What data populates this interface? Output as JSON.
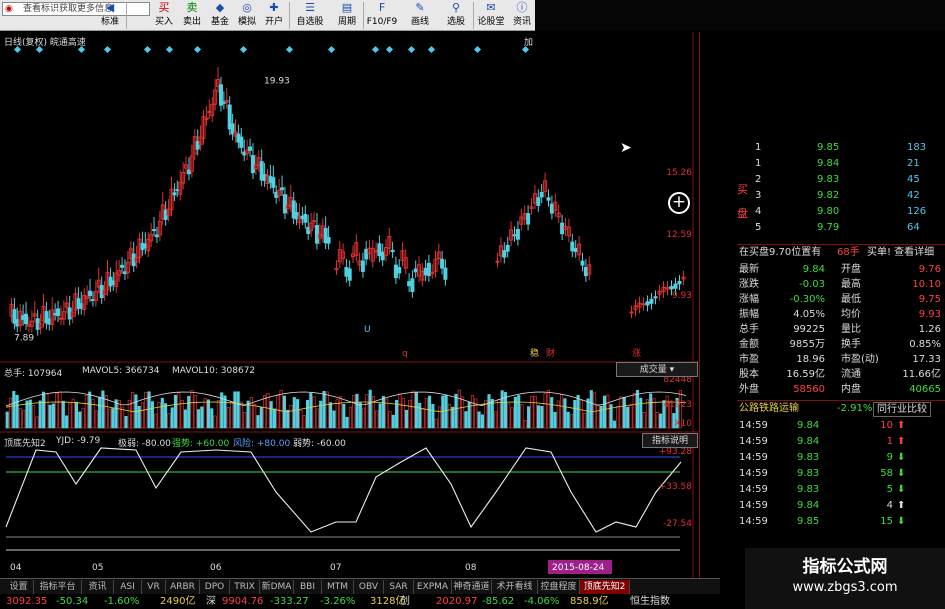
{
  "toolbar": {
    "search_placeholder": "查看标识获取更多信息",
    "buttons": [
      {
        "label": "标准",
        "icon": "arrow-left-icon"
      },
      {
        "label": "买入",
        "icon": "buy-icon"
      },
      {
        "label": "卖出",
        "icon": "sell-icon"
      },
      {
        "label": "基金",
        "icon": "fund-icon"
      },
      {
        "label": "模拟",
        "icon": "simulate-icon"
      },
      {
        "label": "开户",
        "icon": "open-account-icon"
      },
      {
        "label": "自选股",
        "icon": "watchlist-icon"
      },
      {
        "label": "周期",
        "icon": "period-icon"
      },
      {
        "label": "F10/F9",
        "icon": "f10-icon"
      },
      {
        "label": "画线",
        "icon": "draw-line-icon"
      },
      {
        "label": "选股",
        "icon": "select-stock-icon"
      },
      {
        "label": "论股堂",
        "icon": "forum-icon"
      },
      {
        "label": "资讯",
        "icon": "news-icon"
      }
    ]
  },
  "chart": {
    "header": "日线(复权)  皖通高速",
    "header_right": "加",
    "high_label": "19.93",
    "low_label": "7.89",
    "price_ticks": [
      "15.26",
      "12.59",
      "9.93"
    ],
    "markers": {
      "m1": "U",
      "m2": "q",
      "m3": "稳",
      "m4": "财",
      "m5": "涨"
    },
    "vol_header": {
      "total": "总手: 107964",
      "mavol5": "MAVOL5: 366734",
      "mavol10": "MAVOL10: 308672"
    },
    "vol_button": "成交量",
    "vol_ticks": [
      "82448",
      "41923",
      "X10"
    ],
    "ind_header": {
      "name": "顶底先知2",
      "yjd": "YJD: -9.79",
      "weak": "极弱: -80.00",
      "strong": "强势: +60.00",
      "risk": "风险: +80.00",
      "weakness": "弱势: -60.00"
    },
    "ind_button": "指标说明",
    "ind_ticks": [
      "+93.28",
      "+33.58",
      "-27.54"
    ],
    "date_labels": [
      "04",
      "05",
      "06",
      "07",
      "08"
    ],
    "date_highlight": "2015-08-24"
  },
  "chart_data": {
    "type": "candlestick",
    "price_high": 19.93,
    "price_low": 7.89,
    "ylim": [
      7.0,
      21.0
    ]
  },
  "quote": {
    "buy_label": "买盘",
    "order_book": [
      {
        "lvl": "1",
        "price": "9.85",
        "vol": "183"
      },
      {
        "lvl": "1",
        "price": "9.84",
        "vol": "21"
      },
      {
        "lvl": "2",
        "price": "9.83",
        "vol": "45"
      },
      {
        "lvl": "3",
        "price": "9.82",
        "vol": "42"
      },
      {
        "lvl": "4",
        "price": "9.80",
        "vol": "126"
      },
      {
        "lvl": "5",
        "price": "9.79",
        "vol": "64"
      }
    ],
    "pending_text": "在买盘9.70位置有",
    "pending_qty": "68手",
    "pending_action": "买单! 查看详细",
    "stats": [
      {
        "k1": "最新",
        "v1": "9.84",
        "k2": "开盘",
        "v2": "9.76"
      },
      {
        "k1": "涨跌",
        "v1": "-0.03",
        "k2": "最高",
        "v2": "10.10"
      },
      {
        "k1": "涨幅",
        "v1": "-0.30%",
        "k2": "最低",
        "v2": "9.75"
      },
      {
        "k1": "振幅",
        "v1": "4.05%",
        "k2": "均价",
        "v2": "9.93"
      },
      {
        "k1": "总手",
        "v1": "99225",
        "k2": "量比",
        "v2": "1.26"
      },
      {
        "k1": "金额",
        "v1": "9855万",
        "k2": "换手",
        "v2": "0.85%"
      },
      {
        "k1": "市盈",
        "v1": "18.96",
        "k2": "市盈(动)",
        "v2": "17.33"
      },
      {
        "k1": "股本",
        "v1": "16.59亿",
        "k2": "流通",
        "v2": "11.66亿"
      },
      {
        "k1": "外盘",
        "v1": "58560",
        "k2": "内盘",
        "v2": "40665"
      }
    ],
    "industry": {
      "name": "公路铁路运输",
      "pct": "-2.91%",
      "btn": "同行业比较"
    },
    "ticks": [
      {
        "t": "14:59",
        "p": "9.84",
        "v": "10"
      },
      {
        "t": "14:59",
        "p": "9.84",
        "v": "1"
      },
      {
        "t": "14:59",
        "p": "9.83",
        "v": "9"
      },
      {
        "t": "14:59",
        "p": "9.83",
        "v": "58"
      },
      {
        "t": "14:59",
        "p": "9.83",
        "v": "5"
      },
      {
        "t": "14:59",
        "p": "9.84",
        "v": "4"
      },
      {
        "t": "14:59",
        "p": "9.85",
        "v": "15"
      }
    ]
  },
  "tabs": [
    "设置",
    "指标平台",
    "资讯",
    "ASI",
    "VR",
    "ARBR",
    "DPO",
    "TRIX",
    "新DMA",
    "BBI",
    "MTM",
    "OBV",
    "SAR",
    "EXPMA",
    "神奇通道",
    "术开看线",
    "控盘程度",
    "顶底先知2"
  ],
  "status": [
    {
      "label": "3092.35",
      "cls": "red"
    },
    {
      "label": "-50.34",
      "cls": "grn"
    },
    {
      "label": "-1.60%",
      "cls": "grn"
    },
    {
      "label": "2490亿",
      "cls": "yel"
    },
    {
      "label": "深",
      "cls": "wht"
    },
    {
      "label": "9904.76",
      "cls": "red"
    },
    {
      "label": "-333.27",
      "cls": "grn"
    },
    {
      "label": "-3.26%",
      "cls": "grn"
    },
    {
      "label": "3128亿",
      "cls": "yel"
    },
    {
      "label": "创",
      "cls": "wht"
    },
    {
      "label": "2020.97",
      "cls": "red"
    },
    {
      "label": "-85.62",
      "cls": "grn"
    },
    {
      "label": "-4.06%",
      "cls": "grn"
    },
    {
      "label": "858.9亿",
      "cls": "yel"
    },
    {
      "label": "恒生指数",
      "cls": "wht"
    }
  ],
  "watermark": {
    "title": "指标公式网",
    "url": "www.zbgs3.com"
  },
  "colors": {
    "up": "#e03030",
    "down": "#50d0e0",
    "panel_border": "#801010"
  }
}
